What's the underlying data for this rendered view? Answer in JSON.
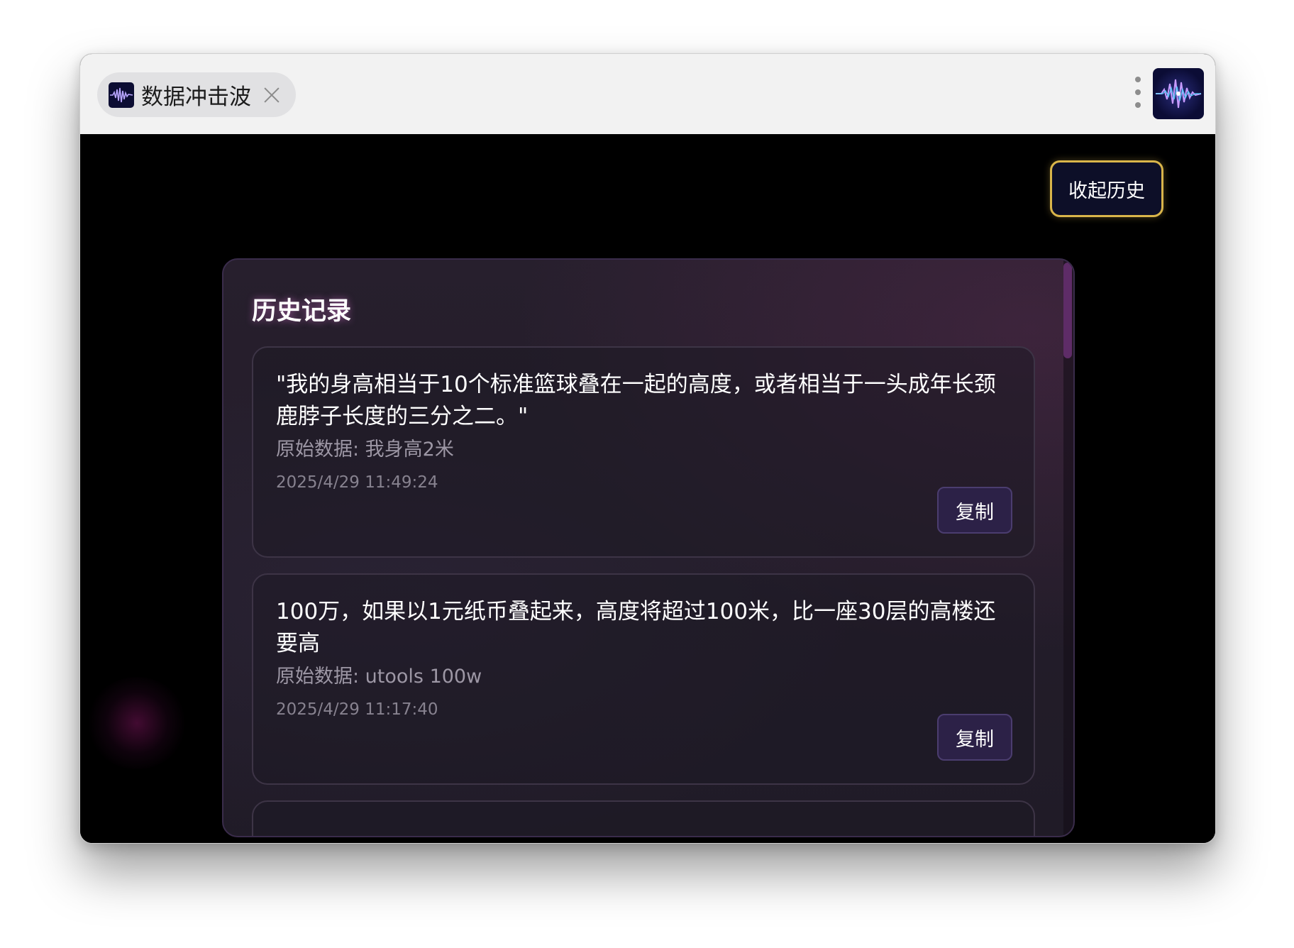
{
  "tab": {
    "title": "数据冲击波",
    "icon": "waveform-icon",
    "close_icon": "close-icon"
  },
  "toolbar": {
    "menu_icon": "more-vertical-icon",
    "app_icon": "waveform-icon"
  },
  "collapse_button": {
    "label": "收起历史"
  },
  "history": {
    "title": "历史记录",
    "items": [
      {
        "text": "\"我的身高相当于10个标准篮球叠在一起的高度，或者相当于一头成年长颈鹿脖子长度的三分之二。\"",
        "origin": "原始数据: 我身高2米",
        "time": "2025/4/29 11:49:24",
        "copy_label": "复制"
      },
      {
        "text": "100万，如果以1元纸币叠起来，高度将超过100米，比一座30层的高楼还要高",
        "origin": "原始数据: utools 100w",
        "time": "2025/4/29 11:17:40",
        "copy_label": "复制"
      }
    ]
  },
  "colors": {
    "accent_border": "#d9b54a",
    "panel_bg": "#231c29",
    "copy_button_bg": "#2c2147",
    "scrollbar": "#5e2c67"
  }
}
